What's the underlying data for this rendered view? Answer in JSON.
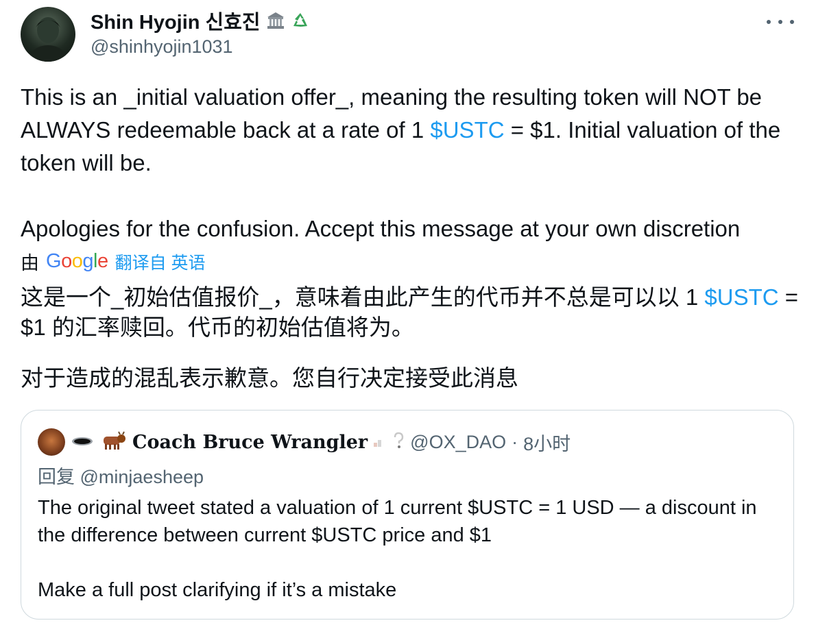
{
  "author": {
    "name": "Shin Hyojin 신효진",
    "handle": "@shinhyojin1031",
    "badge_icons": [
      "classical-building-icon",
      "recycle-icon"
    ]
  },
  "tweet": {
    "para1_a": "This is an _initial valuation offer_, meaning the resulting token will NOT be ALWAYS redeemable back at a rate of 1 ",
    "para1_link": "$USTC",
    "para1_b": " = $1. Initial valuation of the token will be.",
    "para2": "Apologies for the confusion. Accept this message at your own discretion"
  },
  "translation": {
    "by_label": "由",
    "provider": "Google",
    "action_label": "翻译自 英语",
    "zh_para1_a": "这是一个_初始估值报价_，意味着由此产生的代币并不总是可以以 1 ",
    "zh_para1_link": "$USTC",
    "zh_para1_b": " = $1 的汇率赎回。代币的初始估值将为。",
    "zh_para2": "对于造成的混乱表示歉意。您自行决定接受此消息"
  },
  "quote": {
    "name_emojis": [
      "hole-icon",
      "ox-icon"
    ],
    "name": "Coach Bruce Wrangler",
    "name_suffix_emojis": [
      "chart-icon",
      "question-icon"
    ],
    "handle": "@OX_DAO",
    "separator": "·",
    "time": "8小时",
    "reply_to": "回复 @minjaesheep",
    "line1": "The original tweet stated a valuation of 1 current $USTC = 1 USD — a discount in the difference between current $USTC price and $1",
    "line2": "Make a full post clarifying if it’s a mistake"
  },
  "colors": {
    "link": "#1d9bf0",
    "secondary_text": "#536471",
    "border": "#cfd9de"
  }
}
